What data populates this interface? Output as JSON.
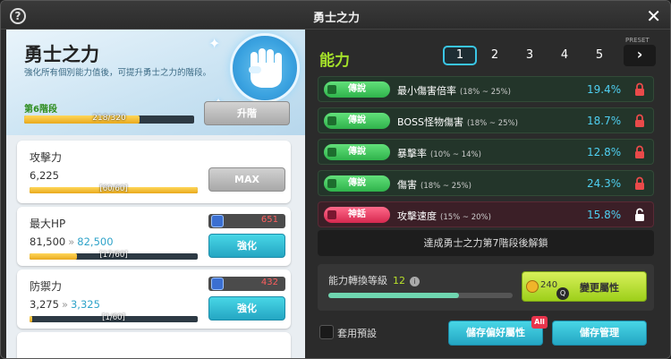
{
  "window": {
    "title": "勇士之力",
    "help_icon": "?",
    "close_icon": "✕"
  },
  "left": {
    "hero_title": "勇士之力",
    "hero_desc": "強化所有個別能力值後，可提升勇士之力的階段。",
    "stage_label": "第6階段",
    "stage_progress_text": "218/320",
    "stage_progress": 0.68,
    "upgrade_label": "升階",
    "cards": [
      {
        "name": "攻擊力",
        "value": "6,225",
        "next": "",
        "progress_text": "[60/60]",
        "progress": 1.0,
        "button": "MAX",
        "cost": ""
      },
      {
        "name": "最大HP",
        "value": "81,500",
        "next": "82,500",
        "progress_text": "[17/60]",
        "progress": 0.283,
        "button": "強化",
        "cost": "651"
      },
      {
        "name": "防禦力",
        "value": "3,275",
        "next": "3,325",
        "progress_text": "[1/60]",
        "progress": 0.017,
        "button": "強化",
        "cost": "432"
      }
    ]
  },
  "right": {
    "title": "能力",
    "preset_label": "PRESET",
    "presets": [
      "1",
      "2",
      "3",
      "4",
      "5"
    ],
    "preset_active": "1",
    "rows": [
      {
        "tier": "傳說",
        "tier_color": "#2fb34b",
        "stat": "最小傷害倍率",
        "range": "(18% ~ 25%)",
        "value": "19.4%",
        "locked": true
      },
      {
        "tier": "傳說",
        "tier_color": "#2fb34b",
        "stat": "BOSS怪物傷害",
        "range": "(18% ~ 25%)",
        "value": "18.7%",
        "locked": true
      },
      {
        "tier": "傳說",
        "tier_color": "#2fb34b",
        "stat": "暴擊率",
        "range": "(10% ~ 14%)",
        "value": "12.8%",
        "locked": true
      },
      {
        "tier": "傳說",
        "tier_color": "#2fb34b",
        "stat": "傷害",
        "range": "(18% ~ 25%)",
        "value": "24.3%",
        "locked": true
      },
      {
        "tier": "神話",
        "tier_color": "#d6284f",
        "stat": "攻擊速度",
        "range": "(15% ~ 20%)",
        "value": "15.8%",
        "locked": false
      }
    ],
    "unlock_note": "達成勇士之力第7階段後解鎖",
    "conversion": {
      "label": "能力轉換等級",
      "level": "12",
      "progress": 0.71
    },
    "change_button": {
      "count": "240",
      "label": "變更屬性"
    },
    "use_preset_label": "套用預設",
    "save_pref_label": "儲存偏好屬性",
    "save_pref_badge": "All",
    "save_manage_label": "儲存管理"
  }
}
